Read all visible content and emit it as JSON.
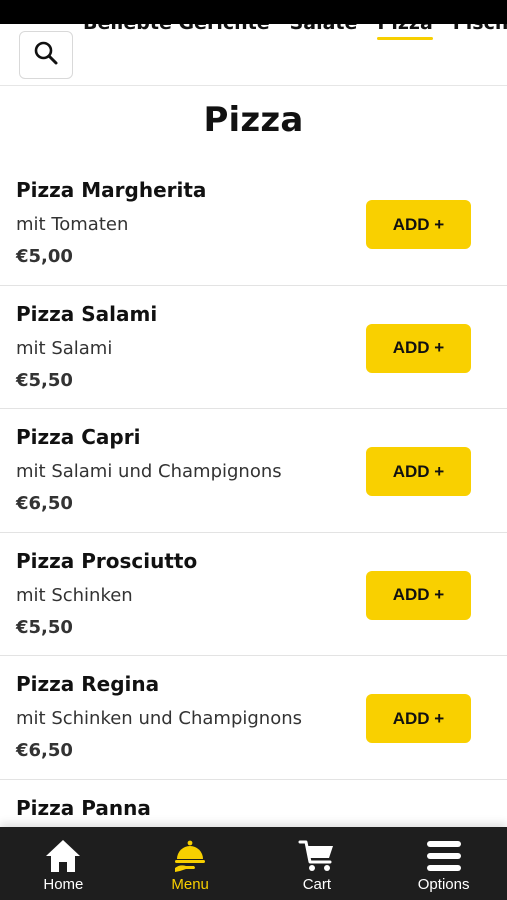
{
  "tabs": [
    {
      "label": "Beliebte Gerichte",
      "active": false
    },
    {
      "label": "Salate",
      "active": false
    },
    {
      "label": "Pizza",
      "active": true
    },
    {
      "label": "Fisch sp",
      "active": false
    }
  ],
  "page_title": "Pizza",
  "items": [
    {
      "name": "Pizza Margherita",
      "desc": "mit Tomaten",
      "price": "€5,00",
      "add": "ADD +"
    },
    {
      "name": "Pizza Salami",
      "desc": "mit Salami",
      "price": "€5,50",
      "add": "ADD +"
    },
    {
      "name": "Pizza Capri",
      "desc": "mit Salami und Champignons",
      "price": "€6,50",
      "add": "ADD +"
    },
    {
      "name": "Pizza Prosciutto",
      "desc": "mit Schinken",
      "price": "€5,50",
      "add": "ADD +"
    },
    {
      "name": "Pizza Regina",
      "desc": "mit Schinken und Champignons",
      "price": "€6,50",
      "add": "ADD +"
    },
    {
      "name": "Pizza Panna",
      "desc": "",
      "price": "",
      "add": ""
    }
  ],
  "nav": [
    {
      "label": "Home",
      "icon": "home-icon",
      "active": false
    },
    {
      "label": "Menu",
      "icon": "menu-cloche-icon",
      "active": true
    },
    {
      "label": "Cart",
      "icon": "cart-icon",
      "active": false
    },
    {
      "label": "Options",
      "icon": "options-icon",
      "active": false
    }
  ],
  "colors": {
    "accent": "#f9d000",
    "nav_bg": "#1e1e1e",
    "status_bar": "#000000"
  }
}
